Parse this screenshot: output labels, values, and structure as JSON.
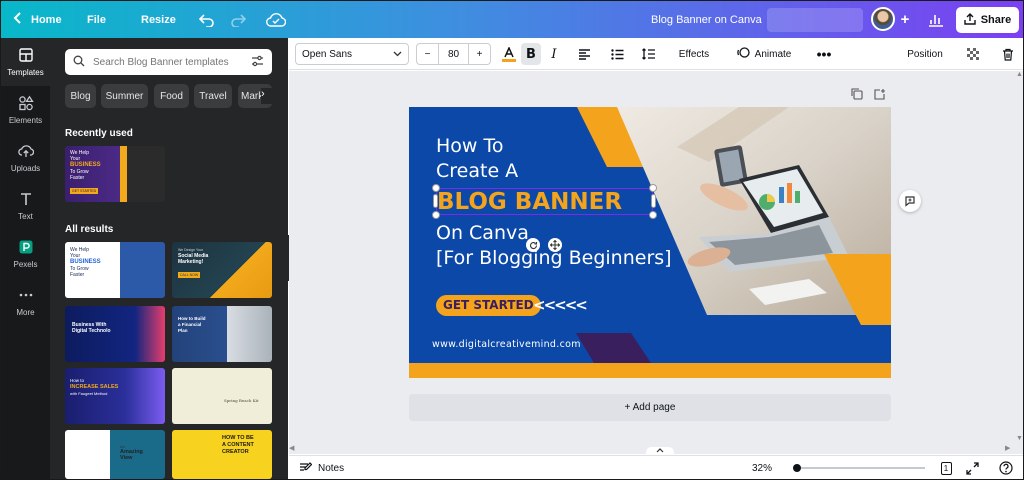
{
  "topbar": {
    "home": "Home",
    "file": "File",
    "resize": "Resize",
    "doc_title": "Blog Banner on Canva",
    "share": "Share"
  },
  "rail": {
    "items": [
      {
        "label": "Templates",
        "icon": "templates-icon"
      },
      {
        "label": "Elements",
        "icon": "elements-icon"
      },
      {
        "label": "Uploads",
        "icon": "uploads-icon"
      },
      {
        "label": "Text",
        "icon": "text-icon"
      },
      {
        "label": "Pexels",
        "icon": "pexels-icon"
      },
      {
        "label": "More",
        "icon": "more-icon"
      }
    ]
  },
  "panel": {
    "search_placeholder": "Search Blog Banner templates",
    "chips": [
      "Blog",
      "Summer",
      "Food",
      "Travel",
      "Marke"
    ],
    "recently_used": "Recently used",
    "all_results": "All results",
    "recent_thumb": {
      "lines": [
        "We Help",
        "Your",
        "BUSINESS",
        "To Grow",
        "Faster"
      ],
      "cta": "GET STARTED"
    },
    "thumbs": [
      {
        "lines": [
          "We Help",
          "Your",
          "BUSINESS",
          "To Grow",
          "Faster"
        ]
      },
      {
        "lines": [
          "We Design Your",
          "Social Media",
          "Marketing!"
        ],
        "cta": "CALL NOW"
      },
      {
        "lines": [
          "Business With",
          "Digital Technolo"
        ]
      },
      {
        "lines": [
          "How to Build",
          "a Financial",
          "Plan"
        ]
      },
      {
        "lines": [
          "How to",
          "INCREASE SALES",
          "with Faugeet Method"
        ]
      },
      {
        "lines": [
          "Spring Reach Kit"
        ]
      },
      {
        "lines": [
          "An",
          "Amazing",
          "View"
        ]
      },
      {
        "lines": [
          "HOW TO BE",
          "A CONTENT",
          "CREATOR"
        ]
      }
    ]
  },
  "toolbar": {
    "font": "Open Sans",
    "size": "80",
    "minus": "−",
    "plus": "+",
    "effects": "Effects",
    "animate": "Animate",
    "position": "Position"
  },
  "design": {
    "line1": "How To",
    "line2": "Create A",
    "highlight": "BLOG BANNER",
    "line3": "On Canva",
    "line4": "[For Blogging Beginners]",
    "cta": "GET STARTED",
    "arrows": "<<<<<",
    "url": "www.digitalcreativemind.com"
  },
  "addpage": "+ Add page",
  "bottombar": {
    "notes": "Notes",
    "zoom": "32%",
    "zoom_level": 0.32,
    "pages": "1"
  },
  "colors": {
    "accent_orange": "#f4a31c",
    "banner_blue": "#0b48a8",
    "selection_purple": "#7d2ae8"
  }
}
